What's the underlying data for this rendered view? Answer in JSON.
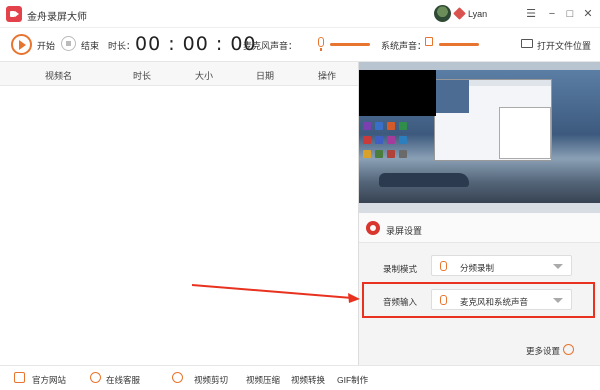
{
  "window": {
    "title": "金舟录屏大师",
    "user": "Lyan"
  },
  "window_controls": {
    "minimize": "−",
    "maximize": "□",
    "close": "✕"
  },
  "toolbar": {
    "start_label": "开始",
    "stop_label": "结束",
    "duration_label": "时长：",
    "duration_value": "00 : 00 : 00",
    "mic_label": "麦克风声音：",
    "system_sound_label": "系统声音：",
    "open_folder_label": "打开文件位置"
  },
  "video_table": {
    "columns": [
      "视频名",
      "时长",
      "大小",
      "日期",
      "操作"
    ],
    "rows": []
  },
  "settings": {
    "title": "录屏设置",
    "record_mode": {
      "label": "录制模式",
      "value": "分频录制"
    },
    "audio_input": {
      "label": "音频输入",
      "value": "麦克风和系统声音"
    },
    "more_label": "更多设置"
  },
  "bottom_bar": {
    "items": [
      "官方网站",
      "在线客服",
      "视频剪切",
      "视频压缩",
      "视频转换",
      "GIF制作"
    ]
  },
  "colors": {
    "accent": "#e8752f",
    "highlight": "#e8321f",
    "brand": "#e3424a"
  }
}
